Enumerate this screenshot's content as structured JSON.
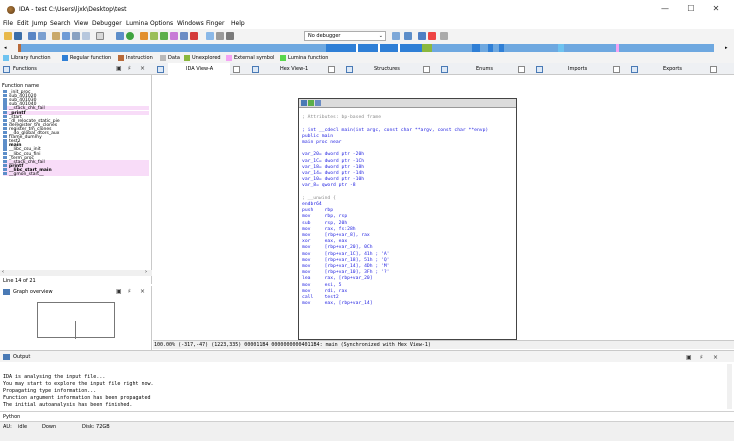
{
  "window": {
    "title": "IDA - test C:\\Users\\ljxk\\Desktop\\test",
    "min": "—",
    "max": "☐",
    "close": "✕"
  },
  "menu": [
    "File",
    "Edit",
    "Jump",
    "Search",
    "View",
    "Debugger",
    "Lumina",
    "Options",
    "Windows",
    "Finger",
    "Help"
  ],
  "toolbar": {
    "debugger_select": "No debugger"
  },
  "legend": [
    {
      "label": "Library function",
      "color": "#6ec3f0"
    },
    {
      "label": "Regular function",
      "color": "#2f7fd6"
    },
    {
      "label": "Instruction",
      "color": "#b86a3a"
    },
    {
      "label": "Data",
      "color": "#b9b9b9"
    },
    {
      "label": "Unexplored",
      "color": "#8bb83e"
    },
    {
      "label": "External symbol",
      "color": "#f4a3f4"
    },
    {
      "label": "Lumina function",
      "color": "#58d64c"
    }
  ],
  "functions_panel": {
    "title": "Functions",
    "column": "Function name",
    "items": [
      {
        "name": "_init_proc",
        "lib": false,
        "bold": false
      },
      {
        "name": "sub_401020",
        "lib": false,
        "bold": false
      },
      {
        "name": "sub_401030",
        "lib": false,
        "bold": false
      },
      {
        "name": "sub_401040",
        "lib": false,
        "bold": false
      },
      {
        "name": "__stack_chk_fail",
        "lib": true,
        "bold": false
      },
      {
        "name": "_printf",
        "lib": true,
        "bold": true
      },
      {
        "name": "_start",
        "lib": false,
        "bold": false
      },
      {
        "name": "_dl_relocate_static_pie",
        "lib": false,
        "bold": false
      },
      {
        "name": "deregister_tm_clones",
        "lib": false,
        "bold": false
      },
      {
        "name": "register_tm_clones",
        "lib": false,
        "bold": false
      },
      {
        "name": "__do_global_dtors_aux",
        "lib": false,
        "bold": false
      },
      {
        "name": "frame_dummy",
        "lib": false,
        "bold": false
      },
      {
        "name": "test2",
        "lib": false,
        "bold": false
      },
      {
        "name": "main",
        "lib": false,
        "bold": true
      },
      {
        "name": "__libc_csu_init",
        "lib": false,
        "bold": false
      },
      {
        "name": "__libc_csu_fini",
        "lib": false,
        "bold": false
      },
      {
        "name": "_term_proc",
        "lib": false,
        "bold": false
      },
      {
        "name": "__stack_chk_fail",
        "lib": true,
        "bold": false
      },
      {
        "name": "printf",
        "lib": true,
        "bold": true
      },
      {
        "name": "__libc_start_main",
        "lib": true,
        "bold": true
      },
      {
        "name": "__gmon_start__",
        "lib": true,
        "bold": false
      }
    ],
    "status": "Line 14 of 21"
  },
  "graph_overview": {
    "title": "Graph overview"
  },
  "tabs": [
    {
      "label": "IDA View-A",
      "active": true
    },
    {
      "label": "Hex View-1",
      "active": false
    },
    {
      "label": "Structures",
      "active": false
    },
    {
      "label": "Enums",
      "active": false
    },
    {
      "label": "Imports",
      "active": false
    },
    {
      "label": "Exports",
      "active": false
    }
  ],
  "code": [
    {
      "text": "",
      "cls": ""
    },
    {
      "text": "; Attributes: bp-based frame",
      "cls": "c-comment"
    },
    {
      "text": "",
      "cls": ""
    },
    {
      "text": "; int __cdecl main(int argc, const char **argv, const char **envp)",
      "cls": "c-blue"
    },
    {
      "text": "public main",
      "cls": "c-blue"
    },
    {
      "text": "main proc near",
      "cls": "c-blue"
    },
    {
      "text": "",
      "cls": ""
    },
    {
      "text": "var_20= dword ptr -20h",
      "cls": "c-blue"
    },
    {
      "text": "var_1C= dword ptr -1Ch",
      "cls": "c-blue"
    },
    {
      "text": "var_18= dword ptr -18h",
      "cls": "c-blue"
    },
    {
      "text": "var_14= dword ptr -14h",
      "cls": "c-blue"
    },
    {
      "text": "var_10= dword ptr -10h",
      "cls": "c-blue"
    },
    {
      "text": "var_8= qword ptr -8",
      "cls": "c-blue"
    },
    {
      "text": "",
      "cls": ""
    },
    {
      "text": "; __unwind {",
      "cls": "c-comment"
    },
    {
      "text": "endbr64",
      "cls": "c-blue"
    },
    {
      "text": "push    rbp",
      "cls": "c-blue"
    },
    {
      "text": "mov     rbp, rsp",
      "cls": "c-blue"
    },
    {
      "text": "sub     rsp, 20h",
      "cls": "c-blue"
    },
    {
      "text": "mov     rax, fs:28h",
      "cls": "c-blue"
    },
    {
      "text": "mov     [rbp+var_8], rax",
      "cls": "c-blue"
    },
    {
      "text": "xor     eax, eax",
      "cls": "c-blue"
    },
    {
      "text": "mov     [rbp+var_20], 0Ch",
      "cls": "c-blue"
    },
    {
      "text": "mov     [rbp+var_1C], 41h ; 'A'",
      "cls": "c-blue"
    },
    {
      "text": "mov     [rbp+var_18], 51h ; 'Q'",
      "cls": "c-blue"
    },
    {
      "text": "mov     [rbp+var_14], 4Dh ; 'M'",
      "cls": "c-blue"
    },
    {
      "text": "mov     [rbp+var_10], 3Fh ; '?'",
      "cls": "c-blue"
    },
    {
      "text": "lea     rax, [rbp+var_20]",
      "cls": "c-blue"
    },
    {
      "text": "mov     esi, 5",
      "cls": "c-blue"
    },
    {
      "text": "mov     rdi, rax",
      "cls": "c-blue"
    },
    {
      "text": "call    test2",
      "cls": "c-blue"
    },
    {
      "text": "mov     eax, [rbp+var_14]",
      "cls": "c-blue"
    }
  ],
  "view_status": "100.00% (-317,-47) (1223,335) 000011B4 00000000004011B4: main (Synchronized with Hex View-1)",
  "output": {
    "title": "Output",
    "lines": [
      "IDA is analysing the input file...",
      "You may start to explore the input file right now.",
      "Propagating type information...",
      "Function argument information has been propagated",
      "The initial autoanalysis has been finished."
    ],
    "prompt": "Python"
  },
  "status": {
    "au": "AU:",
    "state": "idle",
    "dir": "Down",
    "disk": "Disk: 72GB"
  }
}
